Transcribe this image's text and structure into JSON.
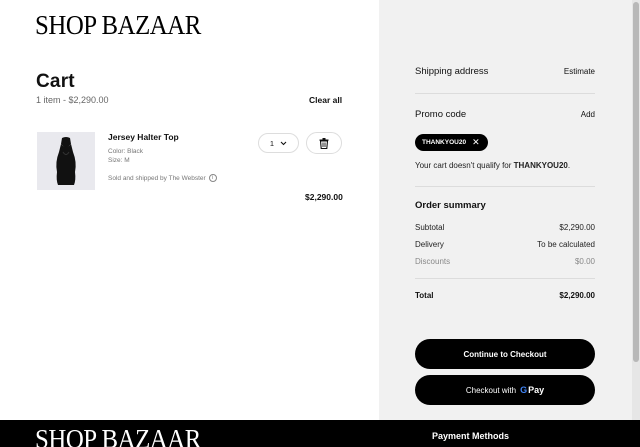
{
  "brand": {
    "logo": "SHOP BAZAAR"
  },
  "cart": {
    "title": "Cart",
    "summary": "1 item - $2,290.00",
    "clear_all": "Clear all",
    "item": {
      "name": "Jersey Halter Top",
      "color": "Color: Black",
      "size": "Size: M",
      "sold_by": "Sold and shipped by The Webster",
      "quantity": "1",
      "price": "$2,290.00"
    }
  },
  "sidebar": {
    "shipping": {
      "label": "Shipping address",
      "action": "Estimate"
    },
    "promo": {
      "label": "Promo code",
      "action": "Add",
      "chip": "THANKYOU20",
      "message_prefix": "Your cart doesn't qualify for ",
      "message_code": "THANKYOU20",
      "message_suffix": "."
    },
    "summary": {
      "title": "Order summary",
      "rows": [
        {
          "label": "Subtotal",
          "value": "$2,290.00"
        },
        {
          "label": "Delivery",
          "value": "To be calculated"
        },
        {
          "label": "Discounts",
          "value": "$0.00"
        }
      ],
      "total": {
        "label": "Total",
        "value": "$2,290.00"
      }
    },
    "buttons": {
      "checkout": "Continue to Checkout",
      "gpay_prefix": "Checkout with",
      "gpay_g": "G",
      "gpay_pay": "Pay"
    }
  },
  "footer": {
    "logo": "SHOP BAZAAR",
    "payment_methods": "Payment Methods"
  },
  "colors": {
    "sidebar_bg": "#f1f1f1",
    "button_bg": "#000000",
    "footer_bg": "#000000",
    "google_blue": "#4285F4"
  }
}
